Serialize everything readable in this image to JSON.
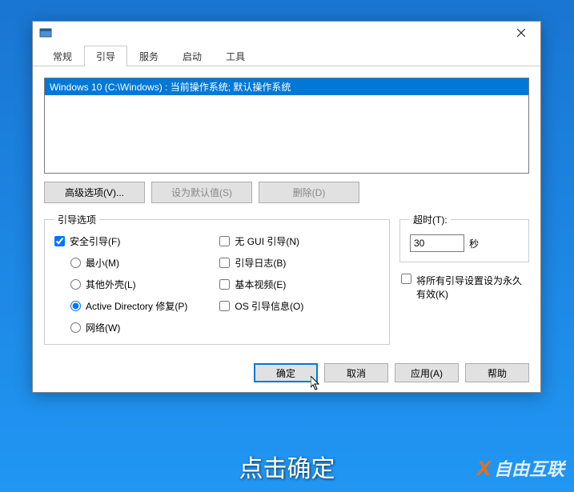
{
  "tabs": {
    "general": "常规",
    "boot": "引导",
    "services": "服务",
    "startup": "启动",
    "tools": "工具"
  },
  "os_list": {
    "item0": "Windows 10 (C:\\Windows) : 当前操作系统; 默认操作系统"
  },
  "buttons": {
    "advanced": "高级选项(V)...",
    "set_default": "设为默认值(S)",
    "delete": "删除(D)"
  },
  "boot_options": {
    "legend": "引导选项",
    "safe_boot": "安全引导(F)",
    "minimal": "最小(M)",
    "alt_shell": "其他外壳(L)",
    "ad_repair": "Active Directory 修复(P)",
    "network": "网络(W)",
    "no_gui": "无 GUI 引导(N)",
    "boot_log": "引导日志(B)",
    "base_video": "基本视频(E)",
    "os_boot_info": "OS 引导信息(O)"
  },
  "timeout": {
    "legend": "超时(T):",
    "value": "30",
    "seconds": "秒"
  },
  "permanent": "将所有引导设置设为永久有效(K)",
  "footer": {
    "ok": "确定",
    "cancel": "取消",
    "apply": "应用(A)",
    "help": "帮助"
  },
  "caption": "点击确定",
  "watermark": "自由互联"
}
